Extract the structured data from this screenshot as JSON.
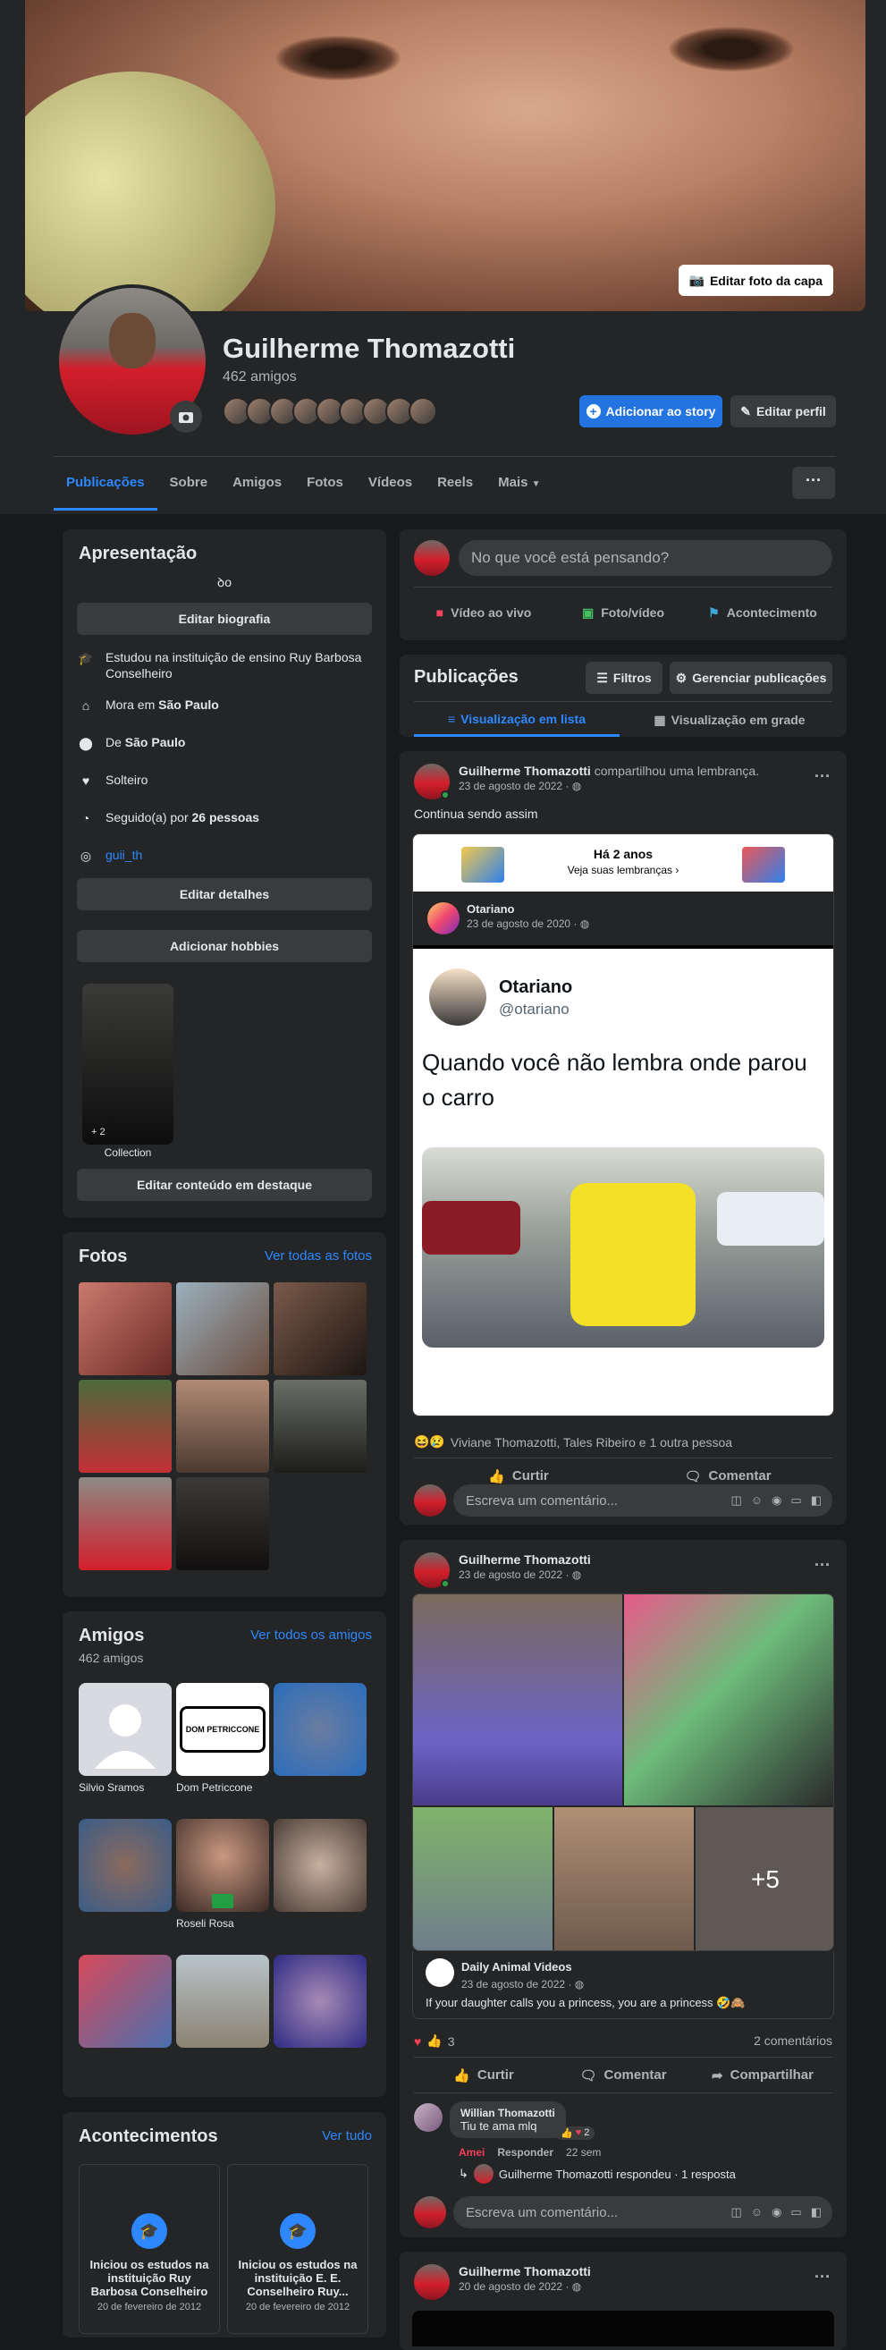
{
  "header": {
    "edit_cover": "Editar foto da capa",
    "name": "Guilherme Thomazotti",
    "friends_count": "462 amigos",
    "add_story": "Adicionar ao story",
    "edit_profile": "Editar perfil"
  },
  "tabs": [
    "Publicações",
    "Sobre",
    "Amigos",
    "Fotos",
    "Vídeos",
    "Reels",
    "Mais"
  ],
  "intro": {
    "title": "Apresentação",
    "bio": "ꝺo",
    "edit_bio": "Editar biografia",
    "items": [
      {
        "icon": "graduation-cap-icon",
        "text": "Estudou na instituição de ensino Ruy Barbosa Conselheiro"
      },
      {
        "icon": "home-icon",
        "prefix": "Mora em",
        "strong": "São Paulo"
      },
      {
        "icon": "location-pin-icon",
        "prefix": "De",
        "strong": "São Paulo"
      },
      {
        "icon": "heart-icon",
        "text": "Solteiro"
      },
      {
        "icon": "rss-icon",
        "prefix": "Seguido(a) por",
        "strong": "26 pessoas"
      },
      {
        "icon": "instagram-icon",
        "link": "guii_th"
      }
    ],
    "edit_details": "Editar detalhes",
    "add_hobbies": "Adicionar hobbies",
    "collection_count": "+ 2",
    "collection_label": "Collection",
    "edit_featured": "Editar conteúdo em destaque"
  },
  "photos": {
    "title": "Fotos",
    "see_all": "Ver todas as fotos"
  },
  "friends": {
    "title": "Amigos",
    "count": "462 amigos",
    "see_all": "Ver todos os amigos",
    "list": [
      {
        "name": "Silvio Sramos"
      },
      {
        "name": "Dom Petriccone"
      },
      {
        "name": ""
      },
      {
        "name": ""
      },
      {
        "name": "Roseli Rosa"
      },
      {
        "name": ""
      },
      {
        "name": ""
      },
      {
        "name": ""
      },
      {
        "name": ""
      }
    ],
    "logo_text": "DOM PETRICCONE"
  },
  "events": {
    "title": "Acontecimentos",
    "see_all": "Ver tudo",
    "items": [
      {
        "text": "Iniciou os estudos na instituição Ruy Barbosa Conselheiro",
        "date": "20 de fevereiro de 2012"
      },
      {
        "text": "Iniciou os estudos na instituição E. E. Conselheiro Ruy...",
        "date": "20 de fevereiro de 2012"
      }
    ]
  },
  "composer": {
    "placeholder": "No que você está pensando?",
    "live": "Vídeo ao vivo",
    "photo": "Foto/vídeo",
    "event": "Acontecimento"
  },
  "pubs": {
    "title": "Publicações",
    "filters": "Filtros",
    "manage": "Gerenciar publicações",
    "list_view": "Visualização em lista",
    "grid_view": "Visualização em grade"
  },
  "post1": {
    "author": "Guilherme Thomazotti",
    "action": "compartilhou uma lembrança.",
    "date": "23 de agosto de 2022 · ",
    "text": "Continua sendo assim",
    "memory_title": "Há 2 anos",
    "memory_sub": "Veja suas lembranças",
    "orig_author": "Otariano",
    "orig_date": "23 de agosto de 2020 · ",
    "tweet_name": "Otariano",
    "tweet_handle": "@otariano",
    "tweet_text": "Quando você não lembra onde parou o carro",
    "reactions": "Viviane Thomazotti, Tales Ribeiro e 1 outra pessoa",
    "like": "Curtir",
    "comment": "Comentar",
    "comment_placeholder": "Escreva um comentário..."
  },
  "post2": {
    "author": "Guilherme Thomazotti",
    "date": "23 de agosto de 2022 · ",
    "more_count": "+5",
    "shared_page": "Daily Animal Videos",
    "shared_date": "23 de agosto de 2022 · ",
    "caption": "If your daughter calls you a princess, you are a princess 🤣🙈",
    "reaction_count": "3",
    "comments_count": "2 comentários",
    "like": "Curtir",
    "comment": "Comentar",
    "share": "Compartilhar",
    "c_author": "Willian Thomazotti",
    "c_text": "Tiu te ama mlq",
    "c_react_count": "2",
    "c_amei": "Amei",
    "c_reply": "Responder",
    "c_time": "22 sem",
    "reply_summary": "Guilherme Thomazotti respondeu · 1 resposta",
    "comment_placeholder": "Escreva um comentário..."
  },
  "post3": {
    "author": "Guilherme Thomazotti",
    "date": "20 de agosto de 2022 · "
  },
  "colors": {
    "bg": "#18191a",
    "card": "#242526",
    "accent": "#2d88ff",
    "button": "#3a3b3c"
  }
}
